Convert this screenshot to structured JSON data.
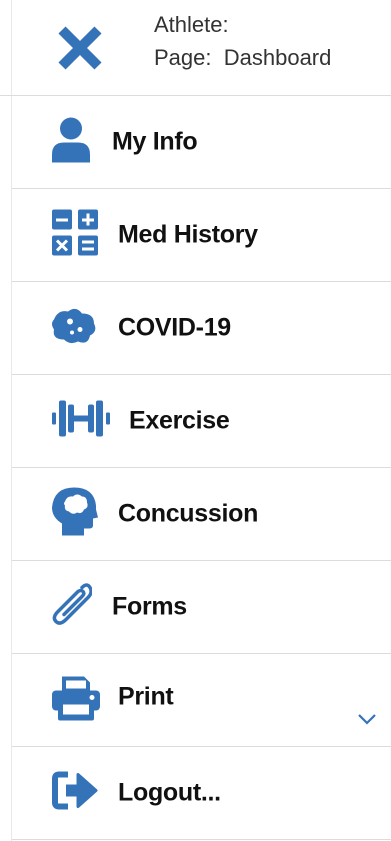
{
  "header": {
    "athlete_label": "Athlete:",
    "page_label": "Page:",
    "page_value": "Dashboard"
  },
  "menu": {
    "items": [
      {
        "label": "My Info",
        "icon": "user-icon"
      },
      {
        "label": "Med History",
        "icon": "calculator-icon"
      },
      {
        "label": "COVID-19",
        "icon": "virus-icon"
      },
      {
        "label": "Exercise",
        "icon": "dumbbell-icon"
      },
      {
        "label": "Concussion",
        "icon": "head-brain-icon"
      },
      {
        "label": "Forms",
        "icon": "paperclip-icon"
      },
      {
        "label": "Print",
        "icon": "printer-icon"
      },
      {
        "label": "Logout...",
        "icon": "sign-out-icon"
      }
    ]
  },
  "colors": {
    "accent": "#3573b9",
    "divider": "#dcdcdc",
    "text": "#111111"
  }
}
